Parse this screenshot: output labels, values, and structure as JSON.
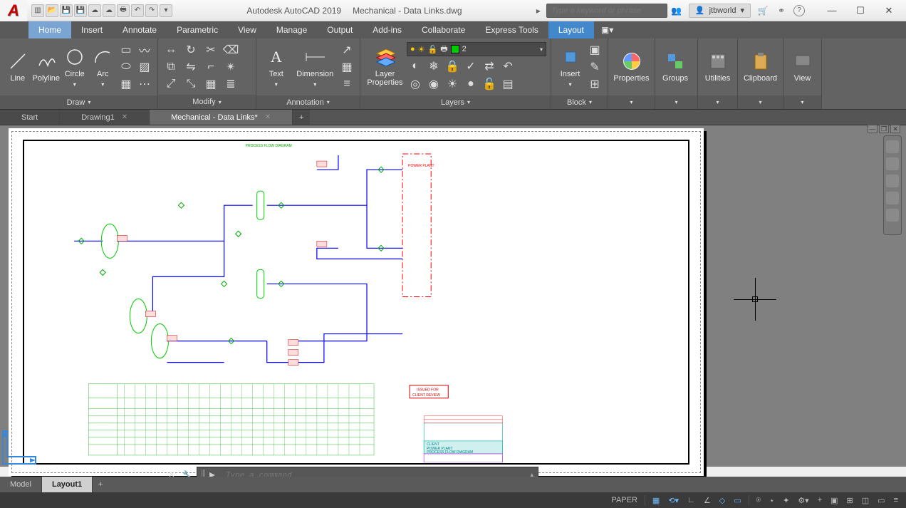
{
  "app": {
    "name": "Autodesk AutoCAD 2019",
    "doc": "Mechanical - Data Links.dwg"
  },
  "search": {
    "placeholder": "Type a keyword or phrase"
  },
  "user": {
    "name": "jtbworld"
  },
  "menu": {
    "items": [
      "Home",
      "Insert",
      "Annotate",
      "Parametric",
      "View",
      "Manage",
      "Output",
      "Add-ins",
      "Collaborate",
      "Express Tools",
      "Layout"
    ],
    "activeHome": "Home",
    "activeLayout": "Layout"
  },
  "ribbon": {
    "draw": {
      "title": "Draw",
      "tools": [
        "Line",
        "Polyline",
        "Circle",
        "Arc"
      ]
    },
    "modify": {
      "title": "Modify"
    },
    "annotation": {
      "title": "Annotation",
      "tools": [
        "Text",
        "Dimension"
      ]
    },
    "layers": {
      "title": "Layers",
      "propBtn": "Layer\nProperties",
      "current": "2"
    },
    "block": {
      "title": "Block",
      "insert": "Insert"
    },
    "properties": {
      "title": "Properties"
    },
    "groups": {
      "title": "Groups"
    },
    "utilities": {
      "title": "Utilities"
    },
    "clipboard": {
      "title": "Clipboard"
    },
    "view": {
      "title": "View"
    }
  },
  "docTabs": {
    "items": [
      "Start",
      "Drawing1",
      "Mechanical - Data Links*"
    ],
    "active": 2
  },
  "drawing": {
    "titleBlock": {
      "client": "CLIENT",
      "project": "POWER PLANT",
      "desc": "PROCESS FLOW DIAGRAM",
      "stamp1": "ISSUED FOR",
      "stamp2": "CLIENT REVIEW",
      "boxLabel": "POWER PLANT"
    }
  },
  "cmd": {
    "placeholder": "Type a command"
  },
  "layoutTabs": {
    "items": [
      "Model",
      "Layout1"
    ],
    "active": 1
  },
  "status": {
    "space": "PAPER"
  }
}
